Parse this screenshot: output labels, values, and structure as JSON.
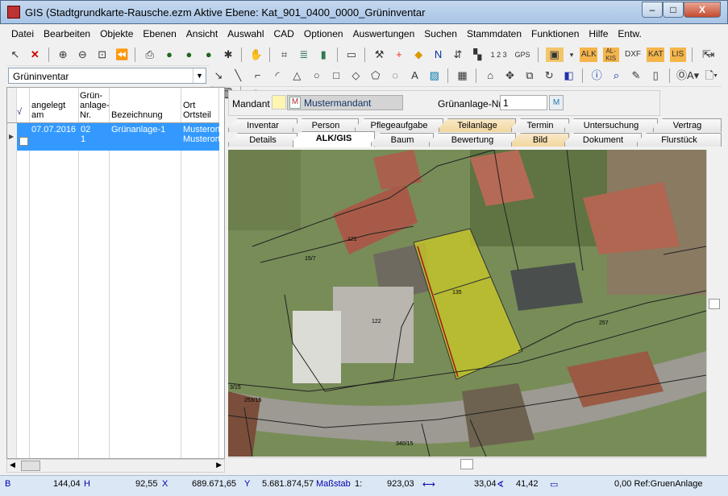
{
  "window": {
    "title": "GIS (Stadtgrundkarte-Rausche.ezm  Aktive Ebene: Kat_901_0400_0000_Grüninventar",
    "minimize": "–",
    "maximize": "□",
    "close": "X"
  },
  "menu": [
    "Datei",
    "Bearbeiten",
    "Objekte",
    "Ebenen",
    "Ansicht",
    "Auswahl",
    "CAD",
    "Optionen",
    "Auswertungen",
    "Suchen",
    "Stammdaten",
    "Funktionen",
    "Hilfe",
    "Entw."
  ],
  "toolbar1": {
    "alk": "ALK",
    "alkis": "AL-KIS",
    "dxf": "DXF",
    "kat": "KAT",
    "lis": "LIS",
    "gps": "GPS",
    "n123": "1 2 3"
  },
  "layer_select": {
    "value": "Grüninventar"
  },
  "grid": {
    "check_header": "√",
    "columns": [
      "angelegt am",
      "Grün-anlage-Nr.",
      "Bezeichnung",
      "Ort Ortsteil"
    ],
    "row": {
      "angelegt": "07.07.2016",
      "nr1": "02",
      "nr2": "1",
      "bezeichnung": "Grünanlage-1",
      "ort1": "Musterort",
      "ort2": "Musterort"
    }
  },
  "form": {
    "mandant_label": "Mandant",
    "mandant_value": "Mustermandant",
    "nr_label": "Grünanlage-Nr.",
    "nr_value": "1"
  },
  "tabs_top": [
    "Inventar",
    "Person",
    "Pflegeaufgabe",
    "Teilanlage",
    "Termin",
    "Untersuchung",
    "Vertrag"
  ],
  "tabs_bottom": [
    "Details",
    "ALK/GIS",
    "Baum",
    "Bewertung",
    "Bild",
    "Dokument",
    "Flurstück"
  ],
  "map_labels": {
    "p121": "121",
    "p157": "15/7",
    "p122": "122",
    "p135": "135",
    "p257": "257",
    "p315": "3/15",
    "p25315": "253/15",
    "p34015": "340/15"
  },
  "status": {
    "b": "B",
    "h_val": "144,04",
    "h": "H",
    "x_val": "92,55",
    "x": "X",
    "y_val": "689.671,65",
    "y": "Y",
    "rw": "5.681.874,57",
    "massstab": "Maßstab",
    "scale_prefix": "1:",
    "scale": "923,03",
    "w1": "33,04",
    "w2": "41,42",
    "ref": "0,00 Ref:GruenAnlage"
  }
}
